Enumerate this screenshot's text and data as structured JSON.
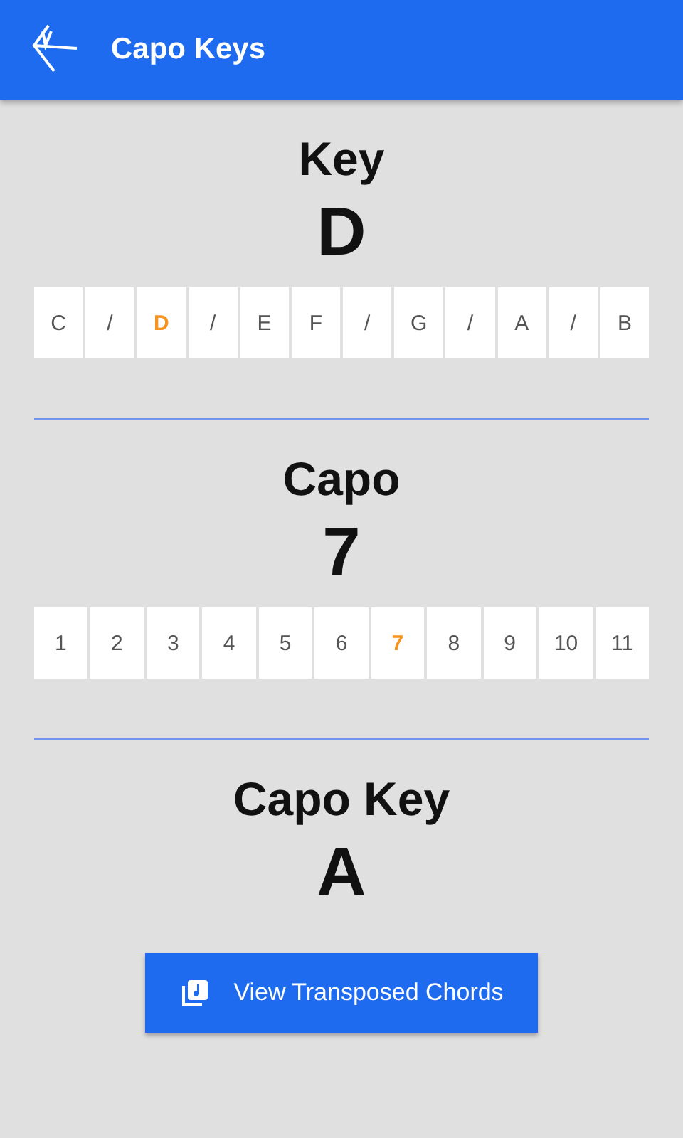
{
  "app_bar": {
    "title": "Capo Keys"
  },
  "sections": [
    {
      "title": "Key",
      "value": "D",
      "options": [
        {
          "label": "C",
          "selected": false
        },
        {
          "label": "/",
          "selected": false
        },
        {
          "label": "D",
          "selected": true
        },
        {
          "label": "/",
          "selected": false
        },
        {
          "label": "E",
          "selected": false
        },
        {
          "label": "F",
          "selected": false
        },
        {
          "label": "/",
          "selected": false
        },
        {
          "label": "G",
          "selected": false
        },
        {
          "label": "/",
          "selected": false
        },
        {
          "label": "A",
          "selected": false
        },
        {
          "label": "/",
          "selected": false
        },
        {
          "label": "B",
          "selected": false
        }
      ]
    },
    {
      "title": "Capo",
      "value": "7",
      "options": [
        {
          "label": "1",
          "selected": false
        },
        {
          "label": "2",
          "selected": false
        },
        {
          "label": "3",
          "selected": false
        },
        {
          "label": "4",
          "selected": false
        },
        {
          "label": "5",
          "selected": false
        },
        {
          "label": "6",
          "selected": false
        },
        {
          "label": "7",
          "selected": true
        },
        {
          "label": "8",
          "selected": false
        },
        {
          "label": "9",
          "selected": false
        },
        {
          "label": "10",
          "selected": false
        },
        {
          "label": "11",
          "selected": false
        }
      ]
    },
    {
      "title": "Capo Key",
      "value": "A"
    }
  ],
  "button": {
    "label": "View Transposed Chords"
  }
}
